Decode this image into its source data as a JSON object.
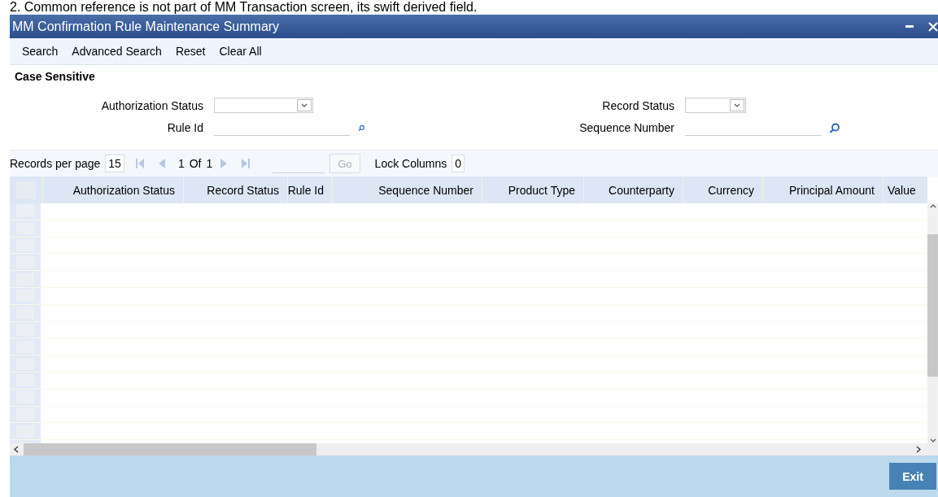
{
  "note": "2. Common reference is not part of MM Transaction screen, its swift derived field.",
  "window": {
    "title": "MM Confirmation Rule Maintenance Summary"
  },
  "toolbar": [
    "Search",
    "Advanced Search",
    "Reset",
    "Clear All"
  ],
  "criteria": {
    "legend": "Case Sensitive",
    "fields": [
      {
        "label": "Authorization Status",
        "kind": "select"
      },
      {
        "label": "Record Status",
        "kind": "select"
      },
      {
        "label": "Rule Id",
        "kind": "lookup"
      },
      {
        "label": "Sequence Number",
        "kind": "lookup"
      }
    ]
  },
  "pager": {
    "records_label": "Records per page",
    "records_per_page": "15",
    "page": "1",
    "of_label": "Of",
    "total": "1",
    "go": "Go",
    "lock_label": "Lock Columns",
    "lock_value": "0"
  },
  "table": {
    "columns": [
      "Authorization Status",
      "Record Status",
      "Rule Id",
      "Sequence Number",
      "Product Type",
      "Counterparty",
      "Currency",
      "Principal Amount",
      "Value"
    ]
  },
  "buttons": [
    "Exit"
  ]
}
